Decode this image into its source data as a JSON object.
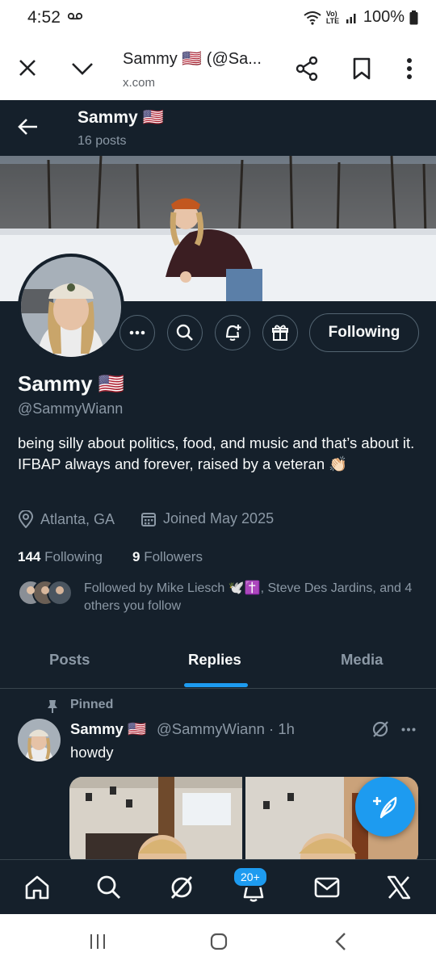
{
  "status_bar": {
    "time": "4:52",
    "voicemail_icon": "voicemail-icon",
    "signal_text": "Vo) LTE",
    "battery": "100%"
  },
  "browser": {
    "title": "Sammy 🇺🇸 (@Sa...",
    "url": "x.com"
  },
  "header": {
    "name": "Sammy 🇺🇸",
    "posts": "16 posts"
  },
  "profile": {
    "display_name": "Sammy 🇺🇸",
    "handle": "@SammyWiann",
    "bio": "being silly about politics, food, and music and that’s about it. IFBAP always and forever, raised by a veteran 👏🏻",
    "location": "Atlanta, GA",
    "joined": "Joined May 2025",
    "following_count": "144",
    "following_label": "Following",
    "followers_count": "9",
    "followers_label": "Followers",
    "followed_by": "Followed by Mike Liesch 🕊️✝️, Steve Des Jardins, and 4 others you follow",
    "follow_button": "Following"
  },
  "tabs": [
    "Posts",
    "Replies",
    "Media"
  ],
  "active_tab": "Replies",
  "pinned_tweet": {
    "pinned_label": "Pinned",
    "name": "Sammy 🇺🇸",
    "handle_time": "@SammyWiann · 1h",
    "text": "howdy"
  },
  "bottom_nav": {
    "notification_badge": "20+"
  },
  "colors": {
    "background": "#15202b",
    "accent": "#1d9bf0",
    "muted": "#8b98a5"
  }
}
